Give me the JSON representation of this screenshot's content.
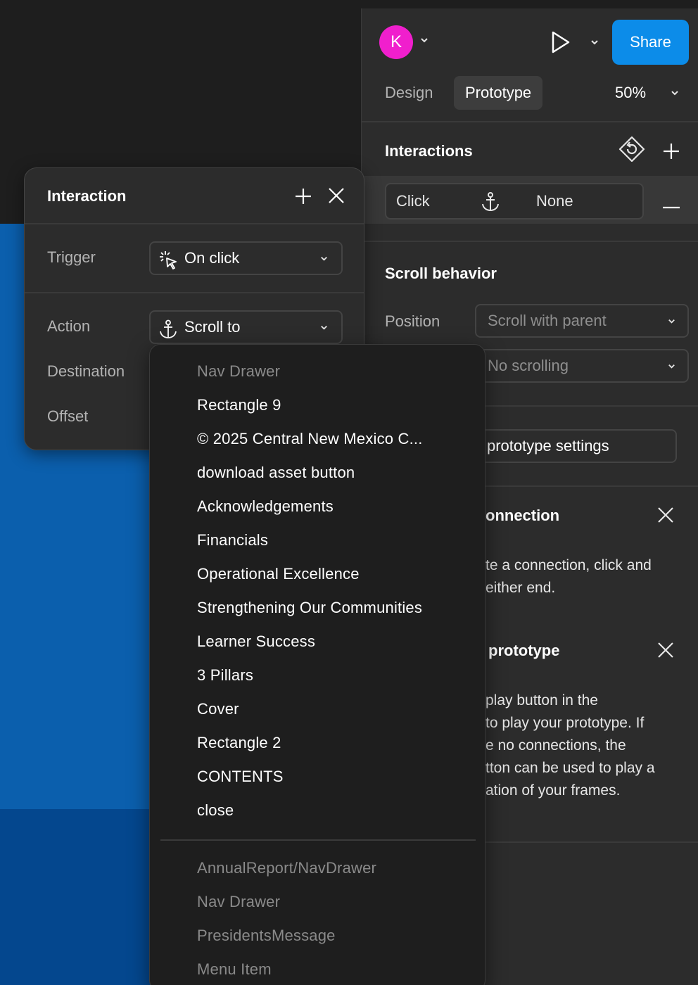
{
  "header": {
    "avatar_initial": "K",
    "share_label": "Share",
    "tabs": [
      {
        "label": "Design",
        "active": false
      },
      {
        "label": "Prototype",
        "active": true
      }
    ],
    "zoom": "50%"
  },
  "interactions_section": {
    "title": "Interactions",
    "row": {
      "trigger": "Click",
      "action": "None"
    }
  },
  "scroll_behavior": {
    "title": "Scroll behavior",
    "position_label": "Position",
    "position_value": "Scroll with parent",
    "overflow_value": "No scrolling"
  },
  "prototype_settings_button": "prototype settings",
  "help_connection": {
    "title": "onnection",
    "body_lines": [
      "te a connection, click and",
      " either end."
    ]
  },
  "help_prototype": {
    "title": "prototype",
    "body_lines": [
      " play button in the",
      "to play your prototype. If",
      "e no connections, the",
      "tton can be used to play a",
      "ation of your frames."
    ]
  },
  "popover": {
    "title": "Interaction",
    "trigger_label": "Trigger",
    "trigger_value": "On click",
    "action_label": "Action",
    "action_value": "Scroll to",
    "destination_label": "Destination",
    "offset_label": "Offset"
  },
  "destination_menu": {
    "items": [
      {
        "label": "Nav Drawer",
        "dim": true
      },
      {
        "label": "Rectangle 9",
        "dim": false
      },
      {
        "label": "© 2025 Central New Mexico C...",
        "dim": false
      },
      {
        "label": "download asset button",
        "dim": false
      },
      {
        "label": "Acknowledgements",
        "dim": false
      },
      {
        "label": "Financials",
        "dim": false
      },
      {
        "label": "Operational Excellence",
        "dim": false
      },
      {
        "label": "Strengthening Our Communities",
        "dim": false
      },
      {
        "label": "Learner Success",
        "dim": false
      },
      {
        "label": "3 Pillars",
        "dim": false
      },
      {
        "label": "Cover",
        "dim": false
      },
      {
        "label": "Rectangle 2",
        "dim": false
      },
      {
        "label": "CONTENTS",
        "dim": false
      },
      {
        "label": "close",
        "dim": false
      }
    ],
    "secondary_items": [
      {
        "label": "AnnualReport/NavDrawer",
        "dim": true
      },
      {
        "label": "Nav Drawer",
        "dim": true
      },
      {
        "label": "PresidentsMessage",
        "dim": true
      },
      {
        "label": "Menu Item",
        "dim": true
      }
    ]
  },
  "colors": {
    "accent": "#0c8ce9",
    "avatar": "#f01fcd",
    "panel_bg": "#2c2c2c",
    "canvas_blue": "#0b5fad"
  }
}
